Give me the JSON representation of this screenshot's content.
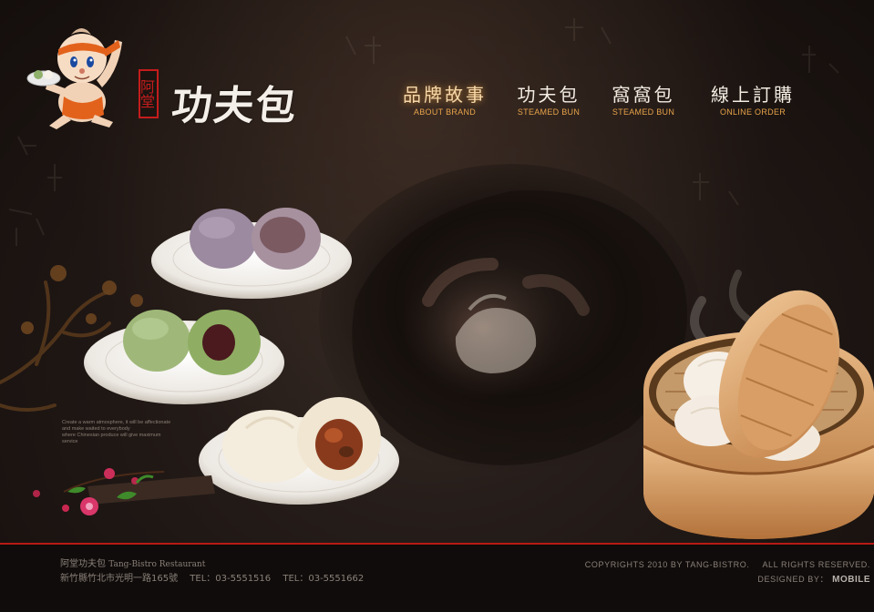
{
  "brand": {
    "seal_text": "阿堂",
    "name": "功夫包"
  },
  "nav": {
    "items": [
      {
        "zh": "品牌故事",
        "en": "ABOUT BRAND"
      },
      {
        "zh": "功夫包",
        "en": "STEAMED BUN"
      },
      {
        "zh": "窩窩包",
        "en": "STEAMED BUN"
      },
      {
        "zh": "線上訂購",
        "en": "ONLINE ORDER"
      }
    ],
    "active_index": 0
  },
  "decor_text": [
    "Create a warm atmosphere, it will be affectionate",
    "and make waited to everybody",
    "where Chinesian produce will give maximum",
    "service"
  ],
  "footer": {
    "name_zh": "阿堂功夫包",
    "name_en": "Tang-Bistro Restaurant",
    "address": "新竹縣竹北市光明一路165號",
    "tel1": "TEL：03-5551516",
    "tel2": "TEL：03-5551662",
    "copyright": "COPYRIGHTS 2010 BY TANG-BISTRO.",
    "rights": "ALL RIGHTS RESERVED.",
    "designed_by": "DESIGNED BY：",
    "designer": "MOBILE"
  },
  "colors": {
    "accent": "#e7a34a",
    "footer_line": "#b81a14",
    "background": "#1f1714"
  },
  "icons": {
    "mascot": "chef-mascot-icon",
    "steamer": "bamboo-steamer-image"
  }
}
